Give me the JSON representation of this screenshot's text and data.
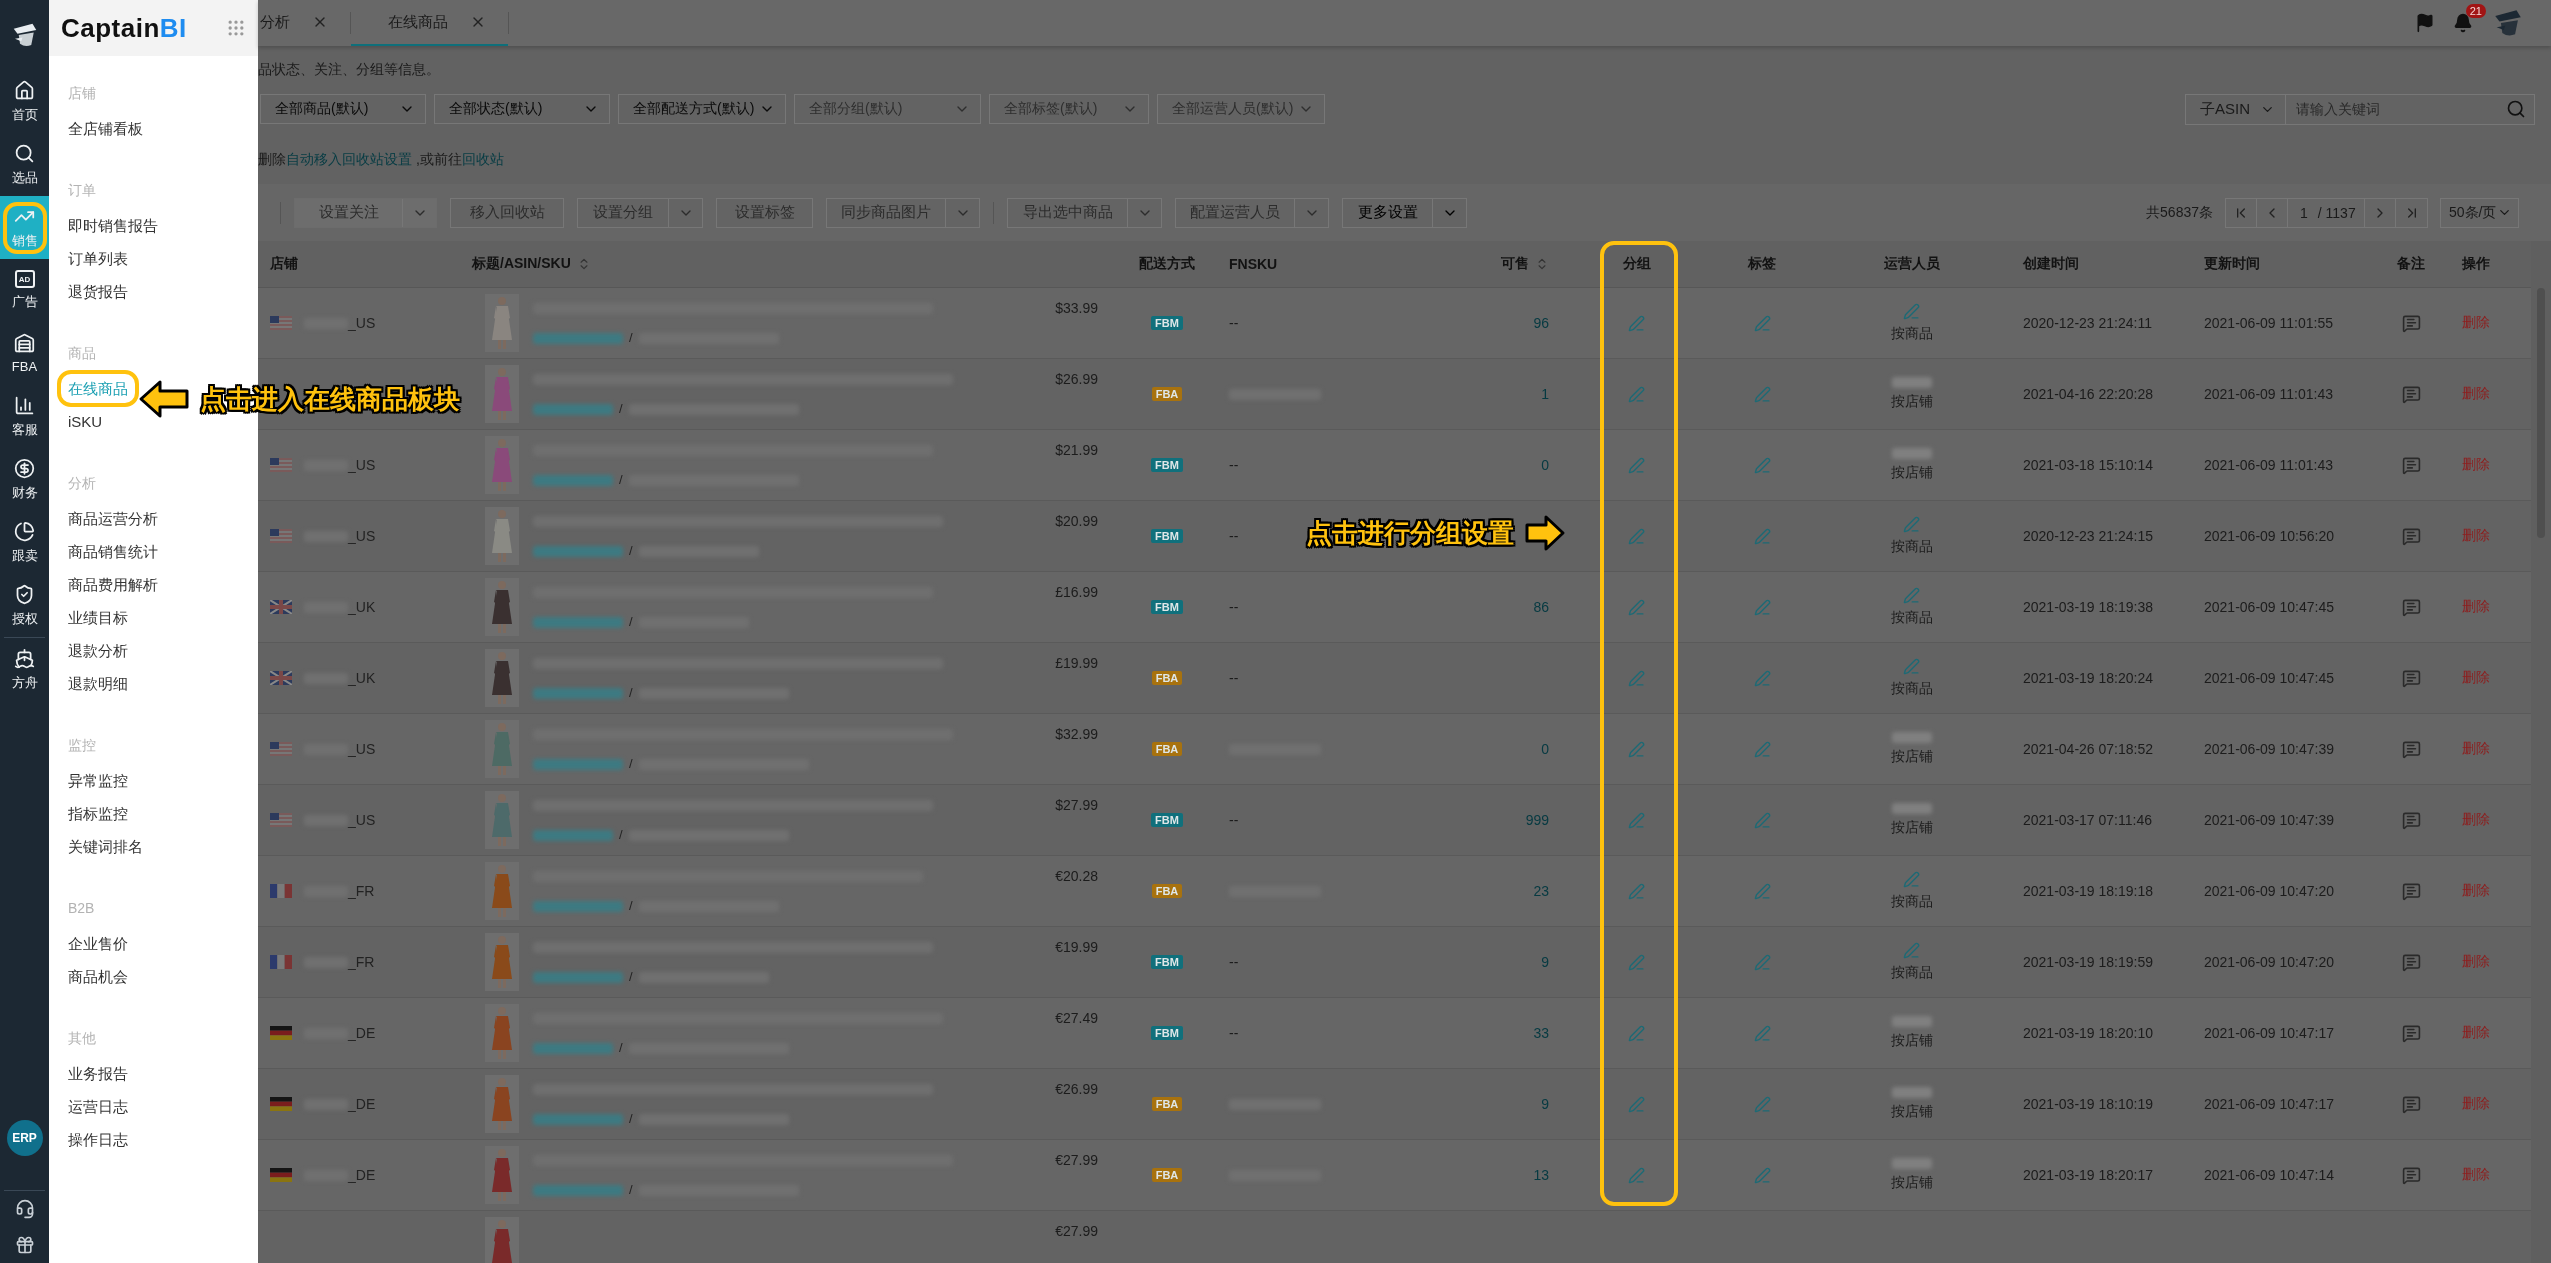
{
  "sidebar": {
    "items": [
      {
        "label": "首页",
        "selected": false
      },
      {
        "label": "选品",
        "selected": false
      },
      {
        "label": "销售",
        "selected": true
      },
      {
        "label": "广告",
        "icon_text": "AD",
        "selected": false
      },
      {
        "label": "FBA",
        "selected": false
      },
      {
        "label": "客服",
        "selected": false
      },
      {
        "label": "财务",
        "selected": false
      },
      {
        "label": "跟卖",
        "selected": false
      },
      {
        "label": "授权",
        "selected": false
      }
    ],
    "extra_items": [
      {
        "label": "方舟",
        "selected": false
      }
    ],
    "erp": "ERP"
  },
  "menu": {
    "logo": {
      "main": "Captain",
      "accent": "BI"
    },
    "sections": [
      {
        "title": "店铺",
        "items": [
          {
            "label": "全店铺看板",
            "selected": false
          }
        ]
      },
      {
        "title": "订单",
        "items": [
          {
            "label": "即时销售报告",
            "selected": false
          },
          {
            "label": "订单列表",
            "selected": false
          },
          {
            "label": "退货报告",
            "selected": false
          }
        ]
      },
      {
        "title": "商品",
        "items": [
          {
            "label": "在线商品",
            "selected": true
          },
          {
            "label": "iSKU",
            "selected": false
          }
        ]
      },
      {
        "title": "分析",
        "items": [
          {
            "label": "商品运营分析",
            "selected": false
          },
          {
            "label": "商品销售统计",
            "selected": false
          },
          {
            "label": "商品费用解析",
            "selected": false
          },
          {
            "label": "业绩目标",
            "selected": false
          },
          {
            "label": "退款分析",
            "selected": false
          },
          {
            "label": "退款明细",
            "selected": false
          }
        ]
      },
      {
        "title": "监控",
        "items": [
          {
            "label": "异常监控",
            "selected": false
          },
          {
            "label": "指标监控",
            "selected": false
          },
          {
            "label": "关键词排名",
            "selected": false
          }
        ]
      },
      {
        "title": "B2B",
        "items": [
          {
            "label": "企业售价",
            "selected": false
          },
          {
            "label": "商品机会",
            "selected": false
          }
        ]
      },
      {
        "title": "其他",
        "items": [
          {
            "label": "业务报告",
            "selected": false
          },
          {
            "label": "运营日志",
            "selected": false
          },
          {
            "label": "操作日志",
            "selected": false
          }
        ]
      }
    ]
  },
  "tabs": [
    {
      "label": "分析",
      "selected": false
    },
    {
      "label": "在线商品",
      "selected": true
    }
  ],
  "notifications": {
    "count": "21"
  },
  "hint": "品状态、关注、分组等信息。",
  "filters": [
    {
      "label": "全部商品(默认)",
      "disabled": false
    },
    {
      "label": "全部状态(默认)",
      "disabled": false
    },
    {
      "label": "全部配送方式(默认)",
      "disabled": false
    },
    {
      "label": "全部分组(默认)",
      "disabled": true
    },
    {
      "label": "全部标签(默认)",
      "disabled": true
    },
    {
      "label": "全部运营人员(默认)",
      "disabled": true
    }
  ],
  "search": {
    "scope": "子ASIN",
    "placeholder": "请输入关键词"
  },
  "recycle_note": {
    "before": "删除",
    "link1": "自动移入回收站设置",
    "middle": " ,或前往",
    "link2": "回收站"
  },
  "toolbar": {
    "buttons": [
      {
        "label": "设置关注",
        "kind": "primary",
        "has_menu": true,
        "disabled": true
      },
      {
        "label": "移入回收站",
        "kind": "default",
        "has_menu": false,
        "disabled": true
      },
      {
        "label": "设置分组",
        "kind": "default",
        "has_menu": true,
        "disabled": true
      },
      {
        "label": "设置标签",
        "kind": "default",
        "has_menu": false,
        "disabled": true
      },
      {
        "label": "同步商品图片",
        "kind": "default",
        "has_menu": true,
        "disabled": true
      },
      {
        "label": "导出选中商品",
        "kind": "default",
        "has_menu": true,
        "disabled": true
      },
      {
        "label": "配置运营人员",
        "kind": "default",
        "has_menu": true,
        "disabled": true
      },
      {
        "label": "更多设置",
        "kind": "default",
        "has_menu": true,
        "disabled": false
      }
    ],
    "total": "共56837条",
    "page": "1",
    "pages": "/ 1137",
    "page_size": "50条/页"
  },
  "table": {
    "columns": [
      {
        "label": "店铺",
        "sortable": false
      },
      {
        "label": "标题/ASIN/SKU",
        "sortable": true
      },
      {
        "label": "配送方式",
        "sortable": false
      },
      {
        "label": "FNSKU",
        "sortable": false
      },
      {
        "label": "可售",
        "sortable": true
      },
      {
        "label": "分组",
        "sortable": false
      },
      {
        "label": "标签",
        "sortable": false
      },
      {
        "label": "运营人员",
        "sortable": false
      },
      {
        "label": "创建时间",
        "sortable": false
      },
      {
        "label": "更新时间",
        "sortable": false
      },
      {
        "label": "备注",
        "sortable": false
      },
      {
        "label": "操作",
        "sortable": false
      }
    ],
    "rows": [
      {
        "flag": {
          "kind": "us"
        },
        "store": "_US",
        "price": "$33.99",
        "sep": "/",
        "ship": {
          "text": "FBM",
          "color": "#10707c"
        },
        "fnsku": {
          "kind": "text",
          "text": "--"
        },
        "stock": "96",
        "operator": {
          "kind": "pen",
          "mode": "按商品"
        },
        "created": "2020-12-23 21:24:11",
        "updated": "2021-06-09 11:01:55",
        "action": "删除"
      },
      {
        "price": "$26.99",
        "sep": "/",
        "ship": {
          "text": "FBA",
          "color": "#a8720e"
        },
        "fnsku": {
          "kind": "blurred"
        },
        "stock": "1",
        "operator": {
          "kind": "hidden-name",
          "mode": "按店铺"
        },
        "created": "2021-04-16 22:20:28",
        "updated": "2021-06-09 11:01:43",
        "action": "删除"
      },
      {
        "flag": {
          "kind": "us"
        },
        "store": "_US",
        "price": "$21.99",
        "sep": "/",
        "ship": {
          "text": "FBM",
          "color": "#10707c"
        },
        "fnsku": {
          "kind": "text",
          "text": "--"
        },
        "stock": "0",
        "operator": {
          "kind": "hidden-name",
          "mode": "按店铺"
        },
        "created": "2021-03-18 15:10:14",
        "updated": "2021-06-09 11:01:43",
        "action": "删除"
      },
      {
        "flag": {
          "kind": "us"
        },
        "store": "_US",
        "price": "$20.99",
        "sep": "/",
        "ship": {
          "text": "FBM",
          "color": "#10707c"
        },
        "fnsku": {
          "kind": "text",
          "text": "--"
        },
        "operator": {
          "kind": "pen",
          "mode": "按商品"
        },
        "created": "2020-12-23 21:24:15",
        "updated": "2021-06-09 10:56:20",
        "action": "删除"
      },
      {
        "flag": {
          "kind": "uk"
        },
        "store": "_UK",
        "price": "£16.99",
        "sep": "/",
        "ship": {
          "text": "FBM",
          "color": "#10707c"
        },
        "fnsku": {
          "kind": "text",
          "text": "--"
        },
        "stock": "86",
        "operator": {
          "kind": "pen",
          "mode": "按商品"
        },
        "created": "2021-03-19 18:19:38",
        "updated": "2021-06-09 10:47:45",
        "action": "删除"
      },
      {
        "flag": {
          "kind": "uk"
        },
        "store": "_UK",
        "price": "£19.99",
        "sep": "/",
        "ship": {
          "text": "FBA",
          "color": "#a8720e"
        },
        "fnsku": {
          "kind": "text",
          "text": "--"
        },
        "operator": {
          "kind": "pen",
          "mode": "按商品"
        },
        "created": "2021-03-19 18:20:24",
        "updated": "2021-06-09 10:47:45",
        "action": "删除"
      },
      {
        "flag": {
          "kind": "us"
        },
        "store": "_US",
        "price": "$32.99",
        "sep": "/",
        "ship": {
          "text": "FBA",
          "color": "#a8720e"
        },
        "fnsku": {
          "kind": "blurred"
        },
        "stock": "0",
        "operator": {
          "kind": "hidden-name",
          "mode": "按店铺"
        },
        "created": "2021-04-26 07:18:52",
        "updated": "2021-06-09 10:47:39",
        "action": "删除"
      },
      {
        "flag": {
          "kind": "us"
        },
        "store": "_US",
        "price": "$27.99",
        "sep": "/",
        "ship": {
          "text": "FBM",
          "color": "#10707c"
        },
        "fnsku": {
          "kind": "text",
          "text": "--"
        },
        "stock": "999",
        "operator": {
          "kind": "hidden-name",
          "mode": "按店铺"
        },
        "created": "2021-03-17 07:11:46",
        "updated": "2021-06-09 10:47:39",
        "action": "删除"
      },
      {
        "flag": {
          "kind": "fr"
        },
        "store": "_FR",
        "price": "€20.28",
        "sep": "/",
        "ship": {
          "text": "FBA",
          "color": "#a8720e"
        },
        "fnsku": {
          "kind": "blurred"
        },
        "stock": "23",
        "operator": {
          "kind": "pen",
          "mode": "按商品"
        },
        "created": "2021-03-19 18:19:18",
        "updated": "2021-06-09 10:47:20",
        "action": "删除"
      },
      {
        "flag": {
          "kind": "fr"
        },
        "store": "_FR",
        "price": "€19.99",
        "sep": "/",
        "ship": {
          "text": "FBM",
          "color": "#10707c"
        },
        "fnsku": {
          "kind": "text",
          "text": "--"
        },
        "stock": "9",
        "operator": {
          "kind": "pen",
          "mode": "按商品"
        },
        "created": "2021-03-19 18:19:59",
        "updated": "2021-06-09 10:47:20",
        "action": "删除"
      },
      {
        "flag": {
          "kind": "de"
        },
        "store": "_DE",
        "price": "€27.49",
        "sep": "/",
        "ship": {
          "text": "FBM",
          "color": "#10707c"
        },
        "fnsku": {
          "kind": "text",
          "text": "--"
        },
        "stock": "33",
        "operator": {
          "kind": "hidden-name",
          "mode": "按店铺"
        },
        "created": "2021-03-19 18:20:10",
        "updated": "2021-06-09 10:47:17",
        "action": "删除"
      },
      {
        "flag": {
          "kind": "de"
        },
        "store": "_DE",
        "price": "€26.99",
        "sep": "/",
        "ship": {
          "text": "FBA",
          "color": "#a8720e"
        },
        "fnsku": {
          "kind": "blurred"
        },
        "stock": "9",
        "operator": {
          "kind": "hidden-name",
          "mode": "按店铺"
        },
        "created": "2021-03-19 18:10:19",
        "updated": "2021-06-09 10:47:17",
        "action": "删除"
      },
      {
        "flag": {
          "kind": "de"
        },
        "store": "_DE",
        "price": "€27.99",
        "sep": "/",
        "ship": {
          "text": "FBA",
          "color": "#a8720e"
        },
        "fnsku": {
          "kind": "blurred"
        },
        "stock": "13",
        "operator": {
          "kind": "hidden-name",
          "mode": "按店铺"
        },
        "created": "2021-03-19 18:20:17",
        "updated": "2021-06-09 10:47:14",
        "action": "删除"
      },
      {
        "price": "€27.99"
      }
    ]
  },
  "annotations": [
    {
      "text": "点击进入在线商品板块"
    },
    {
      "text": "点击进行分组设置"
    }
  ]
}
